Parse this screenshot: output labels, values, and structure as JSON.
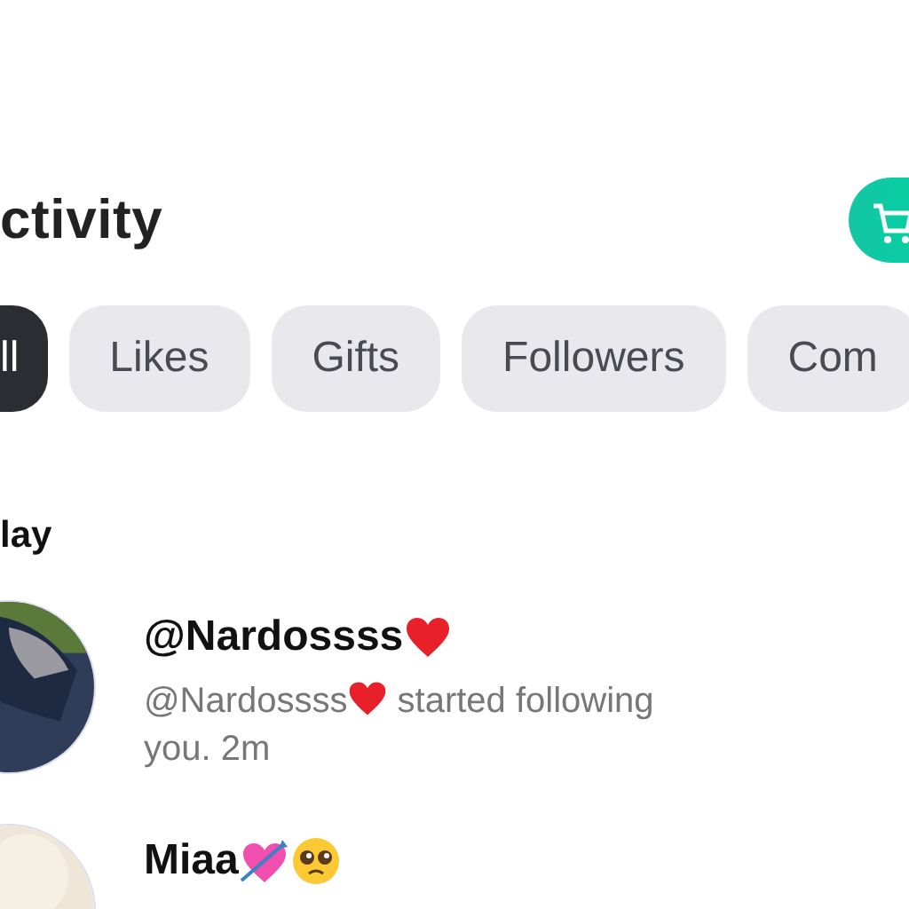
{
  "header": {
    "title": "ctivity",
    "action": {
      "kind": "cart"
    }
  },
  "filters": [
    {
      "label": "ll",
      "selected": true
    },
    {
      "label": "Likes",
      "selected": false
    },
    {
      "label": "Gifts",
      "selected": false
    },
    {
      "label": "Followers",
      "selected": false
    },
    {
      "label": "Com",
      "selected": false
    }
  ],
  "section": {
    "title": "lay"
  },
  "notifications": [
    {
      "name": "@Nardossss",
      "name_icons": [
        {
          "kind": "heart"
        }
      ],
      "message_user": "@Nardossss",
      "message_icons": [
        {
          "kind": "heart"
        }
      ],
      "message_lines": [
        "started following",
        "you. 2m"
      ],
      "avatar": {
        "kind": "picture"
      }
    },
    {
      "name": "Miaa",
      "name_icons": [
        {
          "kind": "heart-arrow"
        },
        {
          "kind": "pleading-face"
        }
      ],
      "avatar": {
        "kind": "picture"
      }
    }
  ]
}
